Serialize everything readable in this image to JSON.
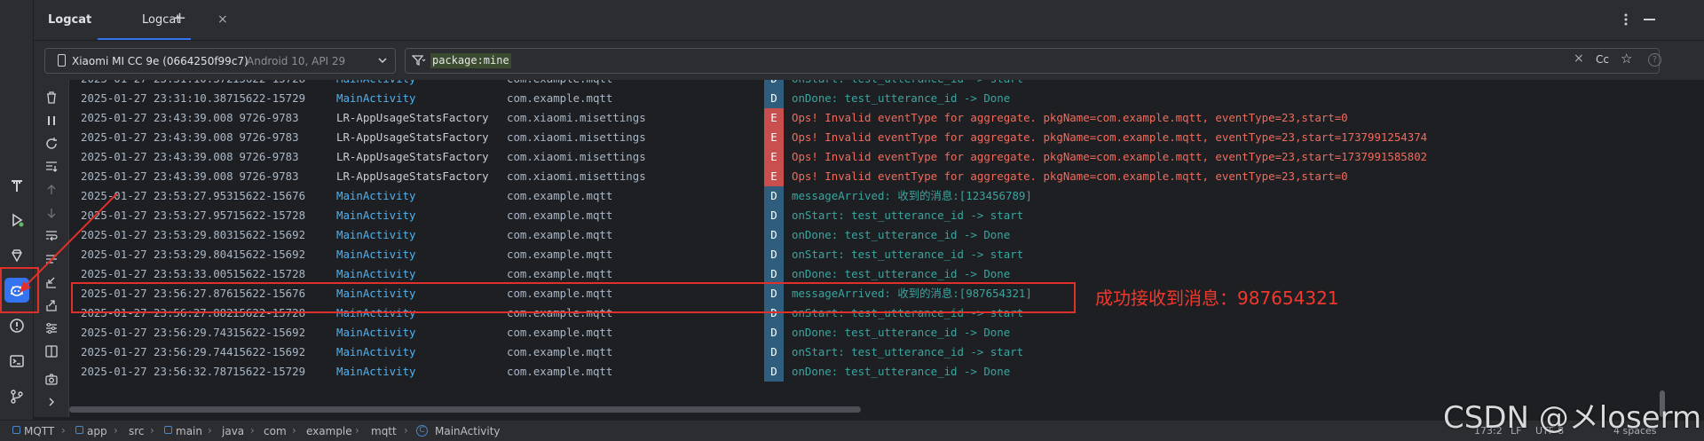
{
  "header": {
    "panel_title": "Logcat",
    "tab_label": "Logcat",
    "close_glyph": "×",
    "add_glyph": "+"
  },
  "device_select": {
    "device_name": "Xiaomi MI CC 9e (0664250f99c7)",
    "device_info": "Android 10, API 29"
  },
  "filter": {
    "query": "package:mine",
    "case_label": "Cc"
  },
  "log_rows": [
    {
      "time": "2025-01-27 23:31:10.387",
      "pid": "15622-15729",
      "tag": "MainActivity",
      "pkg": "com.example.mqtt",
      "level": "D",
      "msg": "onDone: test_utterance_id -> Done"
    },
    {
      "time": "2025-01-27 23:43:39.008",
      "pid": " 9726-9783",
      "tag": "LR-AppUsageStatsFactory",
      "pkg": "com.xiaomi.misettings",
      "level": "E",
      "msg": "Ops! Invalid eventType for aggregate. pkgName=com.example.mqtt, eventType=23,start=0"
    },
    {
      "time": "2025-01-27 23:43:39.008",
      "pid": " 9726-9783",
      "tag": "LR-AppUsageStatsFactory",
      "pkg": "com.xiaomi.misettings",
      "level": "E",
      "msg": "Ops! Invalid eventType for aggregate. pkgName=com.example.mqtt, eventType=23,start=1737991254374"
    },
    {
      "time": "2025-01-27 23:43:39.008",
      "pid": " 9726-9783",
      "tag": "LR-AppUsageStatsFactory",
      "pkg": "com.xiaomi.misettings",
      "level": "E",
      "msg": "Ops! Invalid eventType for aggregate. pkgName=com.example.mqtt, eventType=23,start=1737991585802"
    },
    {
      "time": "2025-01-27 23:43:39.008",
      "pid": " 9726-9783",
      "tag": "LR-AppUsageStatsFactory",
      "pkg": "com.xiaomi.misettings",
      "level": "E",
      "msg": "Ops! Invalid eventType for aggregate. pkgName=com.example.mqtt, eventType=23,start=0"
    },
    {
      "time": "2025-01-27 23:53:27.953",
      "pid": "15622-15676",
      "tag": "MainActivity",
      "pkg": "com.example.mqtt",
      "level": "D",
      "msg": "messageArrived: 收到的消息:[123456789]"
    },
    {
      "time": "2025-01-27 23:53:27.957",
      "pid": "15622-15728",
      "tag": "MainActivity",
      "pkg": "com.example.mqtt",
      "level": "D",
      "msg": "onStart: test_utterance_id -> start"
    },
    {
      "time": "2025-01-27 23:53:29.803",
      "pid": "15622-15692",
      "tag": "MainActivity",
      "pkg": "com.example.mqtt",
      "level": "D",
      "msg": "onDone: test_utterance_id -> Done"
    },
    {
      "time": "2025-01-27 23:53:29.804",
      "pid": "15622-15692",
      "tag": "MainActivity",
      "pkg": "com.example.mqtt",
      "level": "D",
      "msg": "onStart: test_utterance_id -> start"
    },
    {
      "time": "2025-01-27 23:53:33.005",
      "pid": "15622-15728",
      "tag": "MainActivity",
      "pkg": "com.example.mqtt",
      "level": "D",
      "msg": "onDone: test_utterance_id -> Done"
    },
    {
      "time": "2025-01-27 23:56:27.876",
      "pid": "15622-15676",
      "tag": "MainActivity",
      "pkg": "com.example.mqtt",
      "level": "D",
      "msg": "messageArrived: 收到的消息:[987654321]"
    },
    {
      "time": "2025-01-27 23:56:27.882",
      "pid": "15622-15728",
      "tag": "MainActivity",
      "pkg": "com.example.mqtt",
      "level": "D",
      "msg": "onStart: test_utterance_id -> start"
    },
    {
      "time": "2025-01-27 23:56:29.743",
      "pid": "15622-15692",
      "tag": "MainActivity",
      "pkg": "com.example.mqtt",
      "level": "D",
      "msg": "onDone: test_utterance_id -> Done"
    },
    {
      "time": "2025-01-27 23:56:29.744",
      "pid": "15622-15692",
      "tag": "MainActivity",
      "pkg": "com.example.mqtt",
      "level": "D",
      "msg": "onStart: test_utterance_id -> start"
    },
    {
      "time": "2025-01-27 23:56:32.787",
      "pid": "15622-15729",
      "tag": "MainActivity",
      "pkg": "com.example.mqtt",
      "level": "D",
      "msg": "onDone: test_utterance_id -> Done"
    }
  ],
  "annotation": {
    "note": "成功接收到消息：987654321"
  },
  "breadcrumb": [
    "MQTT",
    "app",
    "src",
    "main",
    "java",
    "com",
    "example",
    "mqtt",
    "MainActivity"
  ],
  "status": {
    "position": "173:2",
    "line_sep": "LF",
    "encoding": "UTF-8",
    "indent": "4 spaces"
  },
  "watermark": "CSDN @メloserm",
  "colors": {
    "accent": "#3574f0",
    "tag_main": "#4fb1f0",
    "tag_other": "#c9cbcf",
    "debug_badge": "#2e5d7e",
    "debug_text": "#3aa5a0",
    "error_badge": "#c94f4f",
    "error_text": "#f06b5d",
    "annotation": "#e0302b"
  }
}
